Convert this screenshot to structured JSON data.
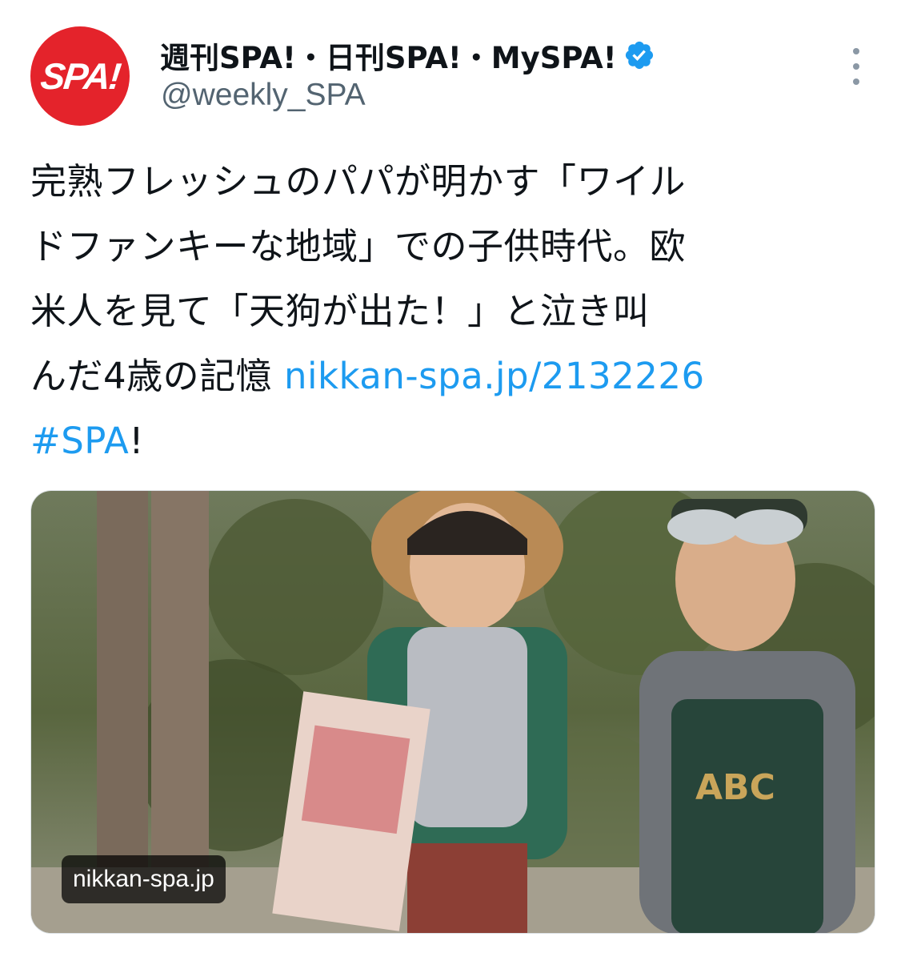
{
  "author": {
    "avatar_text": "SPA!",
    "display_name": "週刊SPA!・日刊SPA!・MySPA!",
    "handle": "@weekly_SPA",
    "verified_icon": "verified-badge-icon",
    "brand_color": "#e4232b"
  },
  "tweet": {
    "lines": [
      "完熟フレッシュのパパが明かす「ワイル",
      "ドファンキーな地域」での子供時代。欧",
      "米人を見て「天狗が出た！」と泣き叫"
    ],
    "line4_prefix": "んだ4歳の記憶 ",
    "link": "nikkan-spa.jp/2132226",
    "hashtag": "#SPA",
    "hashtag_suffix": "!",
    "link_color": "#1d9bf0"
  },
  "media": {
    "domain_badge": "nikkan-spa.jp"
  },
  "menu": {
    "icon": "more-vertical-icon"
  }
}
